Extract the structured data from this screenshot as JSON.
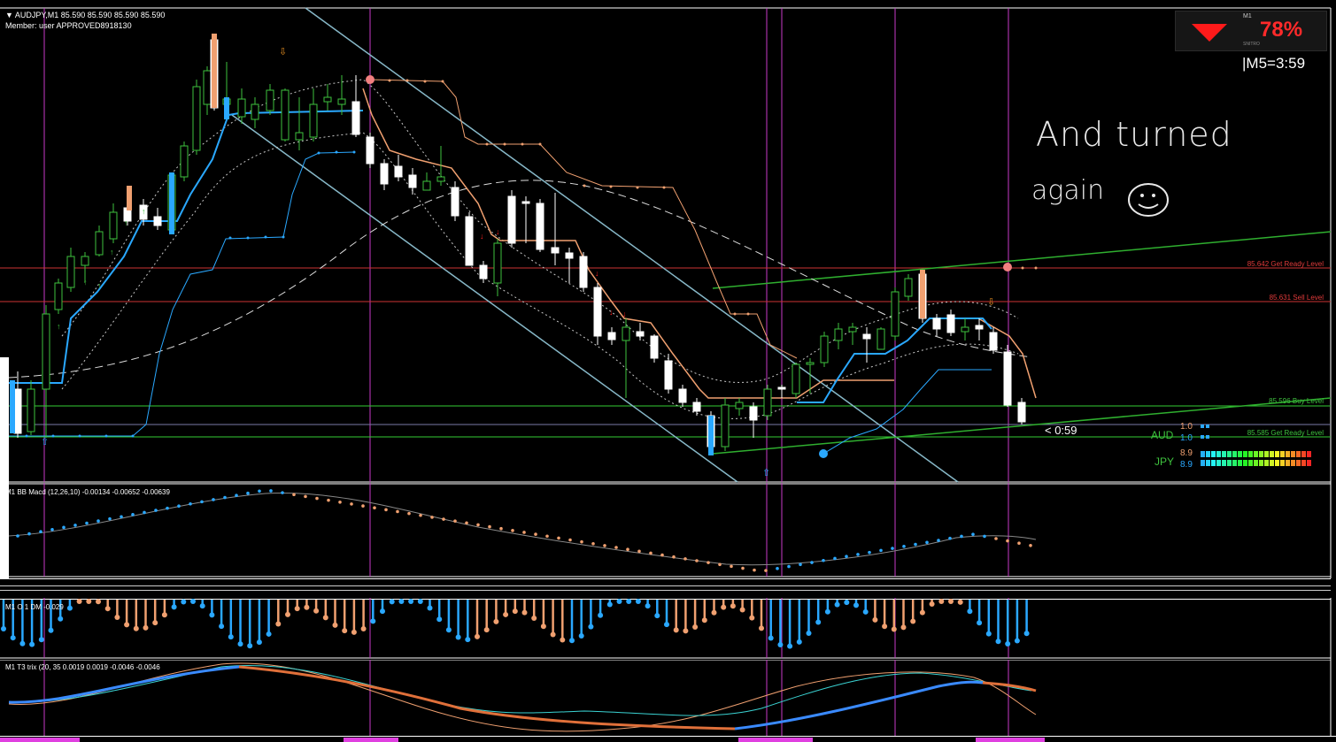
{
  "header": {
    "symbol_line": "AUDJPY,M1  85.590 85.590 85.590 85.590",
    "member_line": "Member: user  APPROVED8918130"
  },
  "snitro": {
    "percent": "78%",
    "m1_label": "M1",
    "brand": "SNITRO"
  },
  "timer": "|M5=3:59",
  "countdown": "< 0:59",
  "annotation": {
    "line1": "And   turned",
    "line2": "again"
  },
  "levels": [
    {
      "label": "85.642 Get Ready Level",
      "color": "#e03a3a"
    },
    {
      "label": "85.631 Sell Level",
      "color": "#e03a3a"
    },
    {
      "label": "85.596 Buy Level",
      "color": "#3ec23e"
    },
    {
      "label": "85.585 Get Ready Level",
      "color": "#3ec23e"
    }
  ],
  "strength": {
    "aud": {
      "label": "AUD",
      "v1": "1.0",
      "v2": "1.0"
    },
    "jpy": {
      "label": "JPY",
      "v1": "8.9",
      "v2": "8.9"
    }
  },
  "subwindows": {
    "macd": "M1 BB Macd (12,26,10) -0.00134 -0.00652 -0.00639",
    "qqe": "M1 O 1  DM -0.029",
    "trix": "M1 T3 trix (20, 35 0.0019 0.0019 -0.0046 -0.0046"
  },
  "colors": {
    "bull": "#ffffff",
    "bear": "#000000",
    "accent_blue": "#2aa8ff",
    "accent_orange": "#f0a070",
    "magenta": "#d23ad2"
  }
}
